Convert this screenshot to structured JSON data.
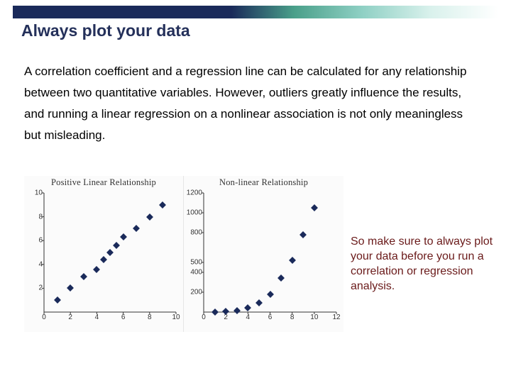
{
  "title": "Always plot your data",
  "body": "A correlation coefficient and a regression line can be calculated for any relationship between two quantitative variables. However, outliers greatly influence the results, and running a linear regression on a nonlinear association is not only meaningless but misleading.",
  "callout": "So make sure to always plot your data before you run a correlation or regression analysis.",
  "chart_data": [
    {
      "type": "scatter",
      "title": "Positive Linear Relationship",
      "xlabel": "",
      "ylabel": "",
      "xlim": [
        0,
        10
      ],
      "ylim": [
        0,
        10
      ],
      "xticks": [
        0,
        2,
        4,
        6,
        8,
        10
      ],
      "yticks": [
        2,
        4,
        6,
        8,
        10
      ],
      "series": [
        {
          "name": "data",
          "points": [
            [
              1.0,
              1.0
            ],
            [
              2.0,
              2.0
            ],
            [
              3.0,
              3.0
            ],
            [
              4.0,
              3.6
            ],
            [
              4.5,
              4.4
            ],
            [
              5.0,
              5.0
            ],
            [
              5.5,
              5.6
            ],
            [
              6.0,
              6.3
            ],
            [
              7.0,
              7.0
            ],
            [
              8.0,
              8.0
            ],
            [
              9.0,
              9.0
            ]
          ]
        }
      ]
    },
    {
      "type": "scatter",
      "title": "Non-linear Relationship",
      "xlabel": "",
      "ylabel": "",
      "xlim": [
        0,
        12
      ],
      "ylim": [
        0,
        1200
      ],
      "xticks": [
        0,
        2,
        4,
        6,
        8,
        10,
        12
      ],
      "yticks": [
        200,
        400,
        500,
        800,
        1000,
        1200
      ],
      "series": [
        {
          "name": "data",
          "points": [
            [
              1,
              2
            ],
            [
              2,
              5
            ],
            [
              3,
              15
            ],
            [
              4,
              40
            ],
            [
              5,
              90
            ],
            [
              6,
              180
            ],
            [
              7,
              340
            ],
            [
              8,
              520
            ],
            [
              9,
              780
            ],
            [
              10,
              1050
            ]
          ]
        }
      ]
    }
  ]
}
